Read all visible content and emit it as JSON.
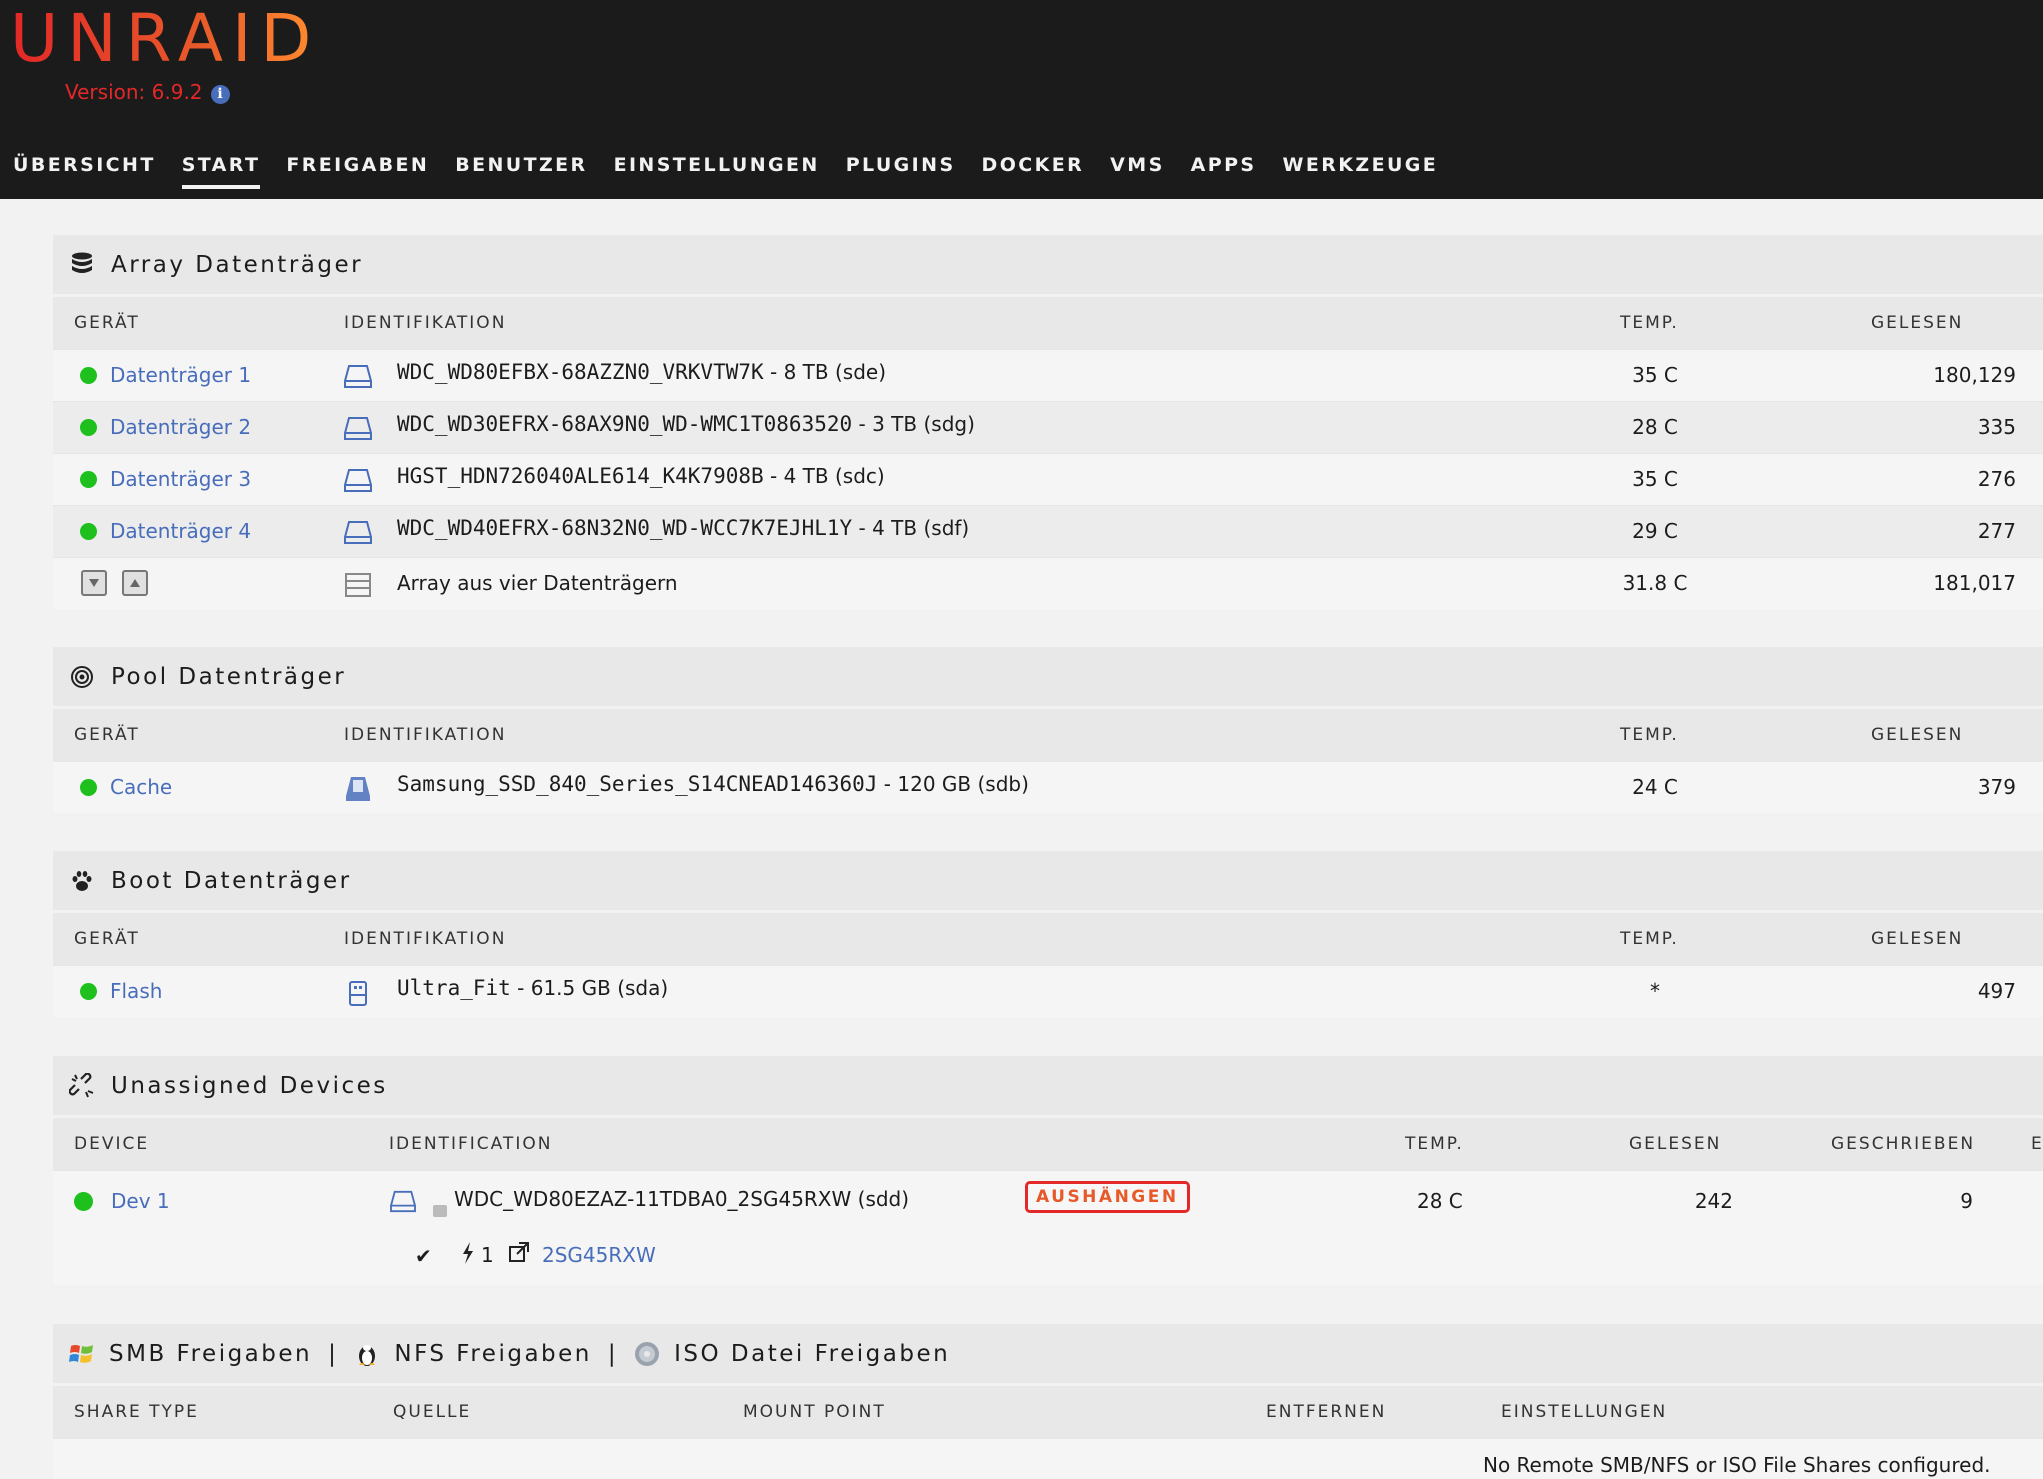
{
  "app": {
    "logo": "UNRAID",
    "version": "Version: 6.9.2"
  },
  "nav": [
    "ÜBERSICHT",
    "START",
    "FREIGABEN",
    "BENUTZER",
    "EINSTELLUNGEN",
    "PLUGINS",
    "DOCKER",
    "VMS",
    "APPS",
    "WERKZEUGE"
  ],
  "nav_active": "START",
  "array": {
    "title": "Array Datenträger",
    "headers": {
      "device": "GERÄT",
      "ident": "IDENTIFIKATION",
      "temp": "TEMP.",
      "read": "GELESEN"
    },
    "rows": [
      {
        "device": "Datenträger 1",
        "ident": "WDC_WD80EFBX-68AZZN0_VRKVTW7K",
        "size": " - 8 TB (sde)",
        "temp": "35 C",
        "read": "180,129"
      },
      {
        "device": "Datenträger 2",
        "ident": "WDC_WD30EFRX-68AX9N0_WD-WMC1T0863520",
        "size": " - 3 TB (sdg)",
        "temp": "28 C",
        "read": "335"
      },
      {
        "device": "Datenträger 3",
        "ident": "HGST_HDN726040ALE614_K4K7908B",
        "size": " - 4 TB (sdc)",
        "temp": "35 C",
        "read": "276"
      },
      {
        "device": "Datenträger 4",
        "ident": "WDC_WD40EFRX-68N32N0_WD-WCC7K7EJHL1Y",
        "size": " - 4 TB (sdf)",
        "temp": "29 C",
        "read": "277"
      }
    ],
    "summary": {
      "ident": "Array aus vier Datenträgern",
      "temp": "31.8 C",
      "read": "181,017"
    }
  },
  "pool": {
    "title": "Pool Datenträger",
    "headers": {
      "device": "GERÄT",
      "ident": "IDENTIFIKATION",
      "temp": "TEMP.",
      "read": "GELESEN"
    },
    "rows": [
      {
        "device": "Cache",
        "ident": "Samsung_SSD_840_Series_S14CNEAD146360J",
        "size": " - 120 GB (sdb)",
        "temp": "24 C",
        "read": "379"
      }
    ]
  },
  "boot": {
    "title": "Boot Datenträger",
    "headers": {
      "device": "GERÄT",
      "ident": "IDENTIFIKATION",
      "temp": "TEMP.",
      "read": "GELESEN"
    },
    "rows": [
      {
        "device": "Flash",
        "ident": "Ultra_Fit",
        "size": " - 61.5 GB (sda)",
        "temp": "*",
        "read": "497"
      }
    ]
  },
  "unassigned": {
    "title": "Unassigned Devices",
    "headers": {
      "device": "DEVICE",
      "ident": "IDENTIFICATION",
      "temp": "TEMP.",
      "read": "GELESEN",
      "written": "GESCHRIEBEN",
      "extra": "E"
    },
    "rows": [
      {
        "device": "Dev 1",
        "ident": "WDC_WD80EZAZ-11TDBA0_2SG45RXW (sdd)",
        "button": "AUSHÄNGEN",
        "temp": "28 C",
        "read": "242",
        "written": "9",
        "partition": {
          "count": "1",
          "link": "2SG45RXW"
        }
      }
    ]
  },
  "shares": {
    "title_smb": "SMB Freigaben",
    "title_nfs": "NFS Freigaben",
    "title_iso": "ISO Datei Freigaben",
    "sep": "|",
    "headers": {
      "type": "SHARE TYPE",
      "source": "QUELLE",
      "mount": "MOUNT POINT",
      "remove": "ENTFERNEN",
      "settings": "EINSTELLUNGEN"
    },
    "empty": "No Remote SMB/NFS or ISO File Shares configured."
  },
  "colors": {
    "accent_red": "#e22828",
    "accent_orange": "#ff8c2f",
    "link": "#486dba",
    "status_green": "#1ec01e",
    "header_bg": "#1c1b1b"
  }
}
